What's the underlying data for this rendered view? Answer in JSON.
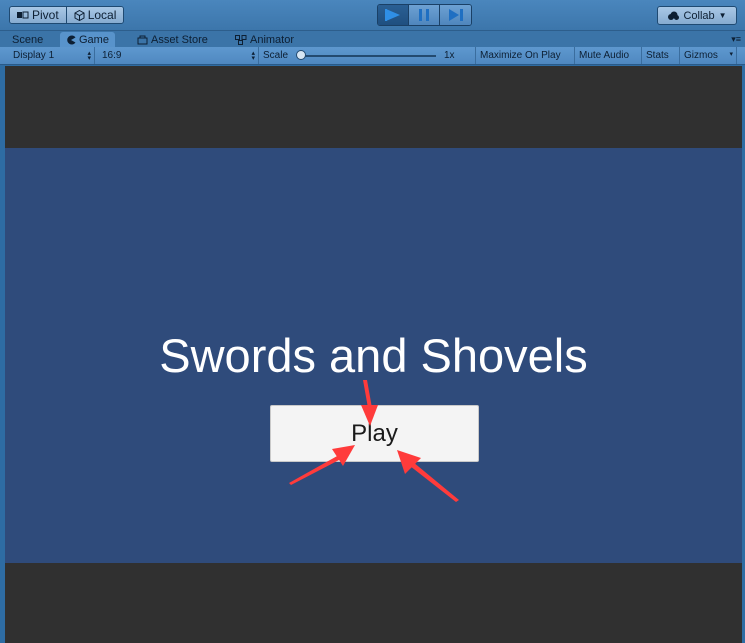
{
  "toolbar": {
    "pivot_label": "Pivot",
    "local_label": "Local",
    "collab_label": "Collab",
    "icons": {
      "pivot": "pivot-icon",
      "local": "local-cube-icon",
      "play": "play-icon",
      "pause": "pause-icon",
      "step": "step-icon",
      "collab": "cloud-icon",
      "dropdown": "chevron-down-icon"
    },
    "play_state": "playing"
  },
  "tabs": [
    {
      "label": "Scene",
      "icon": "",
      "active": false
    },
    {
      "label": "Game",
      "icon": "pacman-icon",
      "active": true
    },
    {
      "label": "Asset Store",
      "icon": "store-icon",
      "active": false
    },
    {
      "label": "Animator",
      "icon": "animator-icon",
      "active": false
    }
  ],
  "gamebar": {
    "display": "Display 1",
    "aspect": "16:9",
    "scale_label": "Scale",
    "scale_value": "1x",
    "scale_fraction": 0.0,
    "maximize": "Maximize On Play",
    "mute": "Mute Audio",
    "stats": "Stats",
    "gizmos": "Gizmos"
  },
  "game": {
    "title": "Swords and Shovels",
    "play_button": "Play",
    "background_color": "#2f4b7b",
    "letterbox_color": "#303030",
    "annotation_color": "#ff3b3b"
  }
}
